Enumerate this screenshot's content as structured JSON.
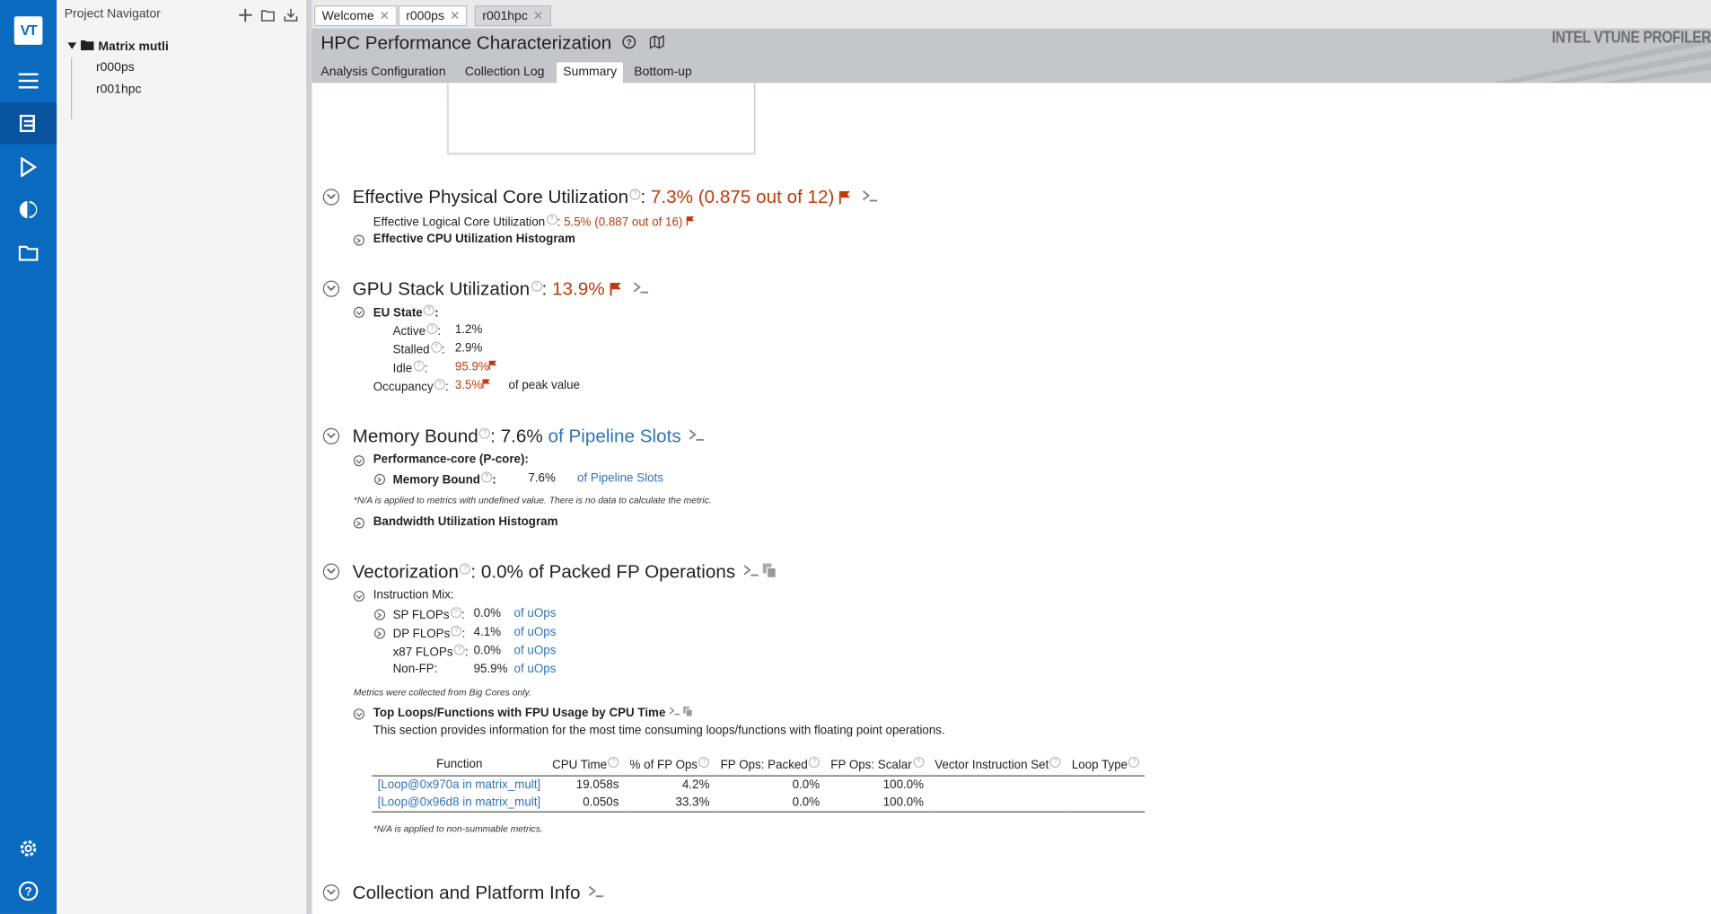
{
  "app": {
    "logo_text": "VT",
    "brand": "INTEL VTUNE PROFILER",
    "brand_color": "#0a6ac0"
  },
  "rail": {
    "icons": [
      "menu-icon",
      "projects-icon",
      "run-icon",
      "compare-icon",
      "open-folder-icon",
      "settings-icon",
      "help-icon"
    ]
  },
  "navigator": {
    "title": "Project Navigator",
    "project": "Matrix mutli",
    "results": [
      "r000ps",
      "r001hpc"
    ]
  },
  "doc_tabs": [
    {
      "label": "Welcome",
      "active": false
    },
    {
      "label": "r000ps",
      "active": false
    },
    {
      "label": "r001hpc",
      "active": true
    }
  ],
  "header": {
    "title": "HPC Performance Characterization"
  },
  "sub_tabs": [
    {
      "label": "Analysis Configuration",
      "active": false
    },
    {
      "label": "Collection Log",
      "active": false
    },
    {
      "label": "Summary",
      "active": true
    },
    {
      "label": "Bottom-up",
      "active": false
    }
  ],
  "summary": {
    "cpu": {
      "title": "Effective Physical Core Utilization",
      "value": "7.3% (0.875 out of 12)",
      "logical_label": "Effective Logical Core Utilization",
      "logical_value": "5.5% (0.887 out of 16)",
      "histogram": "Effective CPU Utilization Histogram"
    },
    "gpu": {
      "title": "GPU Stack Utilization",
      "value": "13.9%",
      "eu_state": "EU State",
      "active_label": "Active",
      "active_value": "1.2%",
      "stalled_label": "Stalled",
      "stalled_value": "2.9%",
      "idle_label": "Idle",
      "idle_value": "95.9%",
      "occupancy_label": "Occupancy",
      "occupancy_value": "3.5%",
      "occupancy_suffix": "of peak value"
    },
    "memory": {
      "title": "Memory Bound",
      "value": "7.6%",
      "unit": "of Pipeline Slots",
      "pcore": "Performance-core (P-core):",
      "row_label": "Memory Bound",
      "row_value": "7.6%",
      "row_unit": "of Pipeline Slots",
      "note": "*N/A is applied to metrics with undefined value. There is no data to calculate the metric.",
      "histogram": "Bandwidth Utilization Histogram"
    },
    "vector": {
      "title": "Vectorization",
      "value": "0.0% of Packed FP Operations",
      "mix": "Instruction Mix:",
      "rows": [
        {
          "label": "SP FLOPs",
          "value": "0.0%",
          "unit": "of uOps"
        },
        {
          "label": "DP FLOPs",
          "value": "4.1%",
          "unit": "of uOps"
        },
        {
          "label": "x87 FLOPs",
          "value": "0.0%",
          "unit": "of uOps"
        },
        {
          "label": "Non-FP",
          "value": "95.9%",
          "unit": "of uOps"
        }
      ],
      "note": "Metrics were collected from Big Cores only.",
      "top_loops": "Top Loops/Functions with FPU Usage by CPU Time",
      "top_desc": "This section provides information for the most time consuming loops/functions with floating point operations.",
      "columns": [
        "Function",
        "CPU Time",
        "% of FP Ops",
        "FP Ops: Packed",
        "FP Ops: Scalar",
        "Vector Instruction Set",
        "Loop Type"
      ],
      "table": [
        [
          "[Loop@0x970a in matrix_mult]",
          "19.058s",
          "4.2%",
          "0.0%",
          "100.0%",
          "",
          ""
        ],
        [
          "[Loop@0x96d8 in matrix_mult]",
          "0.050s",
          "33.3%",
          "0.0%",
          "100.0%",
          "",
          ""
        ]
      ],
      "table_note": "*N/A is applied to non-summable metrics."
    },
    "collection": {
      "title": "Collection and Platform Info"
    }
  },
  "colors": {
    "flag": "#c0390a",
    "link": "#2f73b8",
    "header_bg": "#c3c6cb"
  }
}
